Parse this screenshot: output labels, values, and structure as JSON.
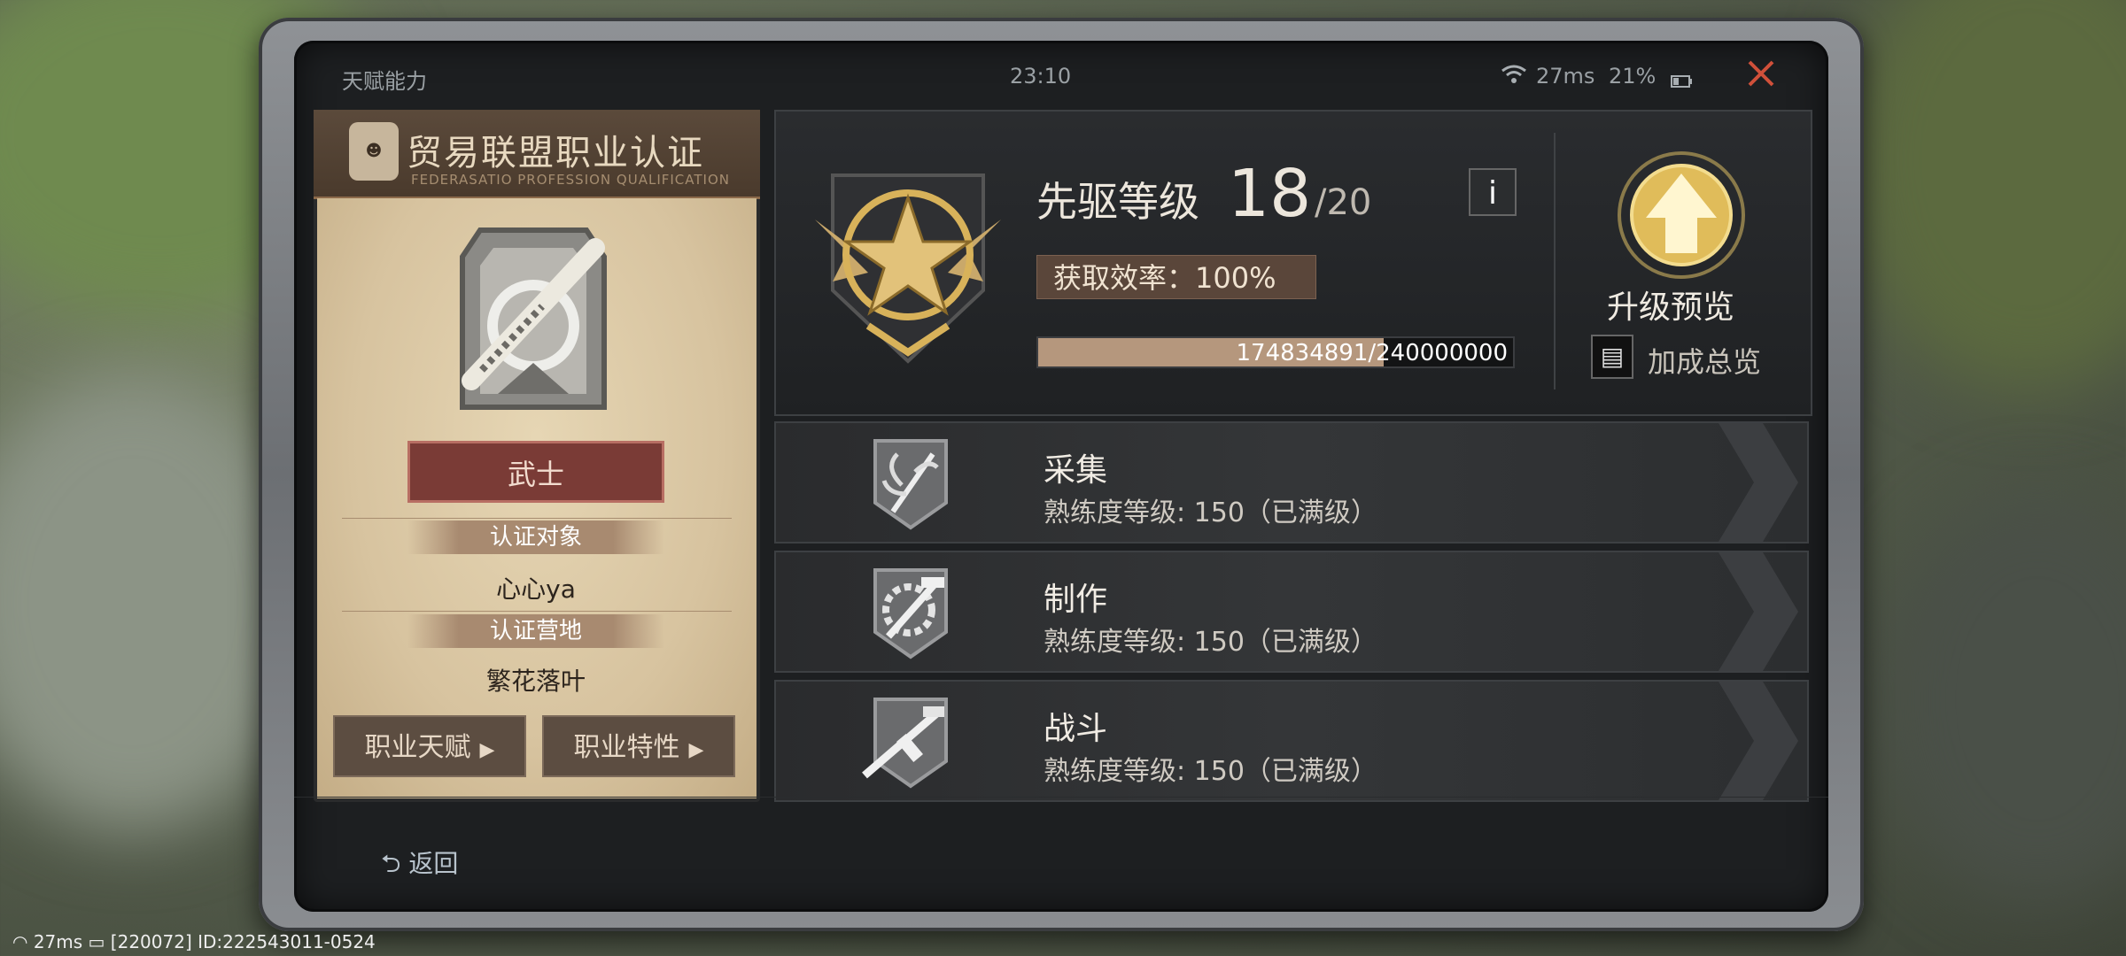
{
  "status": {
    "screen_title": "天赋能力",
    "time": "23:10",
    "ping": "27ms",
    "battery": "21%"
  },
  "certificate": {
    "title": "贸易联盟职业认证",
    "subtitle": "FEDERASATIO PROFESSION QUALIFICATION",
    "class_name": "武士",
    "target_label": "认证对象",
    "target_value": "心心ya",
    "camp_label": "认证营地",
    "camp_value": "繁花落叶",
    "btn_talent": "职业天赋",
    "btn_traits": "职业特性"
  },
  "rank": {
    "title": "先驱等级",
    "level": "18",
    "max": "/20",
    "info": "i",
    "efficiency": "获取效率：100%",
    "xp_text": "174834891/240000000",
    "xp_progress": 0.728,
    "upgrade_preview": "升级预览",
    "bonus_overview": "加成总览"
  },
  "skills": [
    {
      "name": "采集",
      "level": "熟练度等级: 150（已满级）",
      "icon": "gathering-icon"
    },
    {
      "name": "制作",
      "level": "熟练度等级: 150（已满级）",
      "icon": "crafting-icon"
    },
    {
      "name": "战斗",
      "level": "熟练度等级: 150（已满级）",
      "icon": "combat-icon"
    }
  ],
  "footer": {
    "back": "返回",
    "ping": "27ms",
    "id_text": "[220072] ID:222543011-0524"
  },
  "colors": {
    "accent_gold": "#d8b25a",
    "class_red": "#7a3b36",
    "close_red": "#d0503a"
  }
}
